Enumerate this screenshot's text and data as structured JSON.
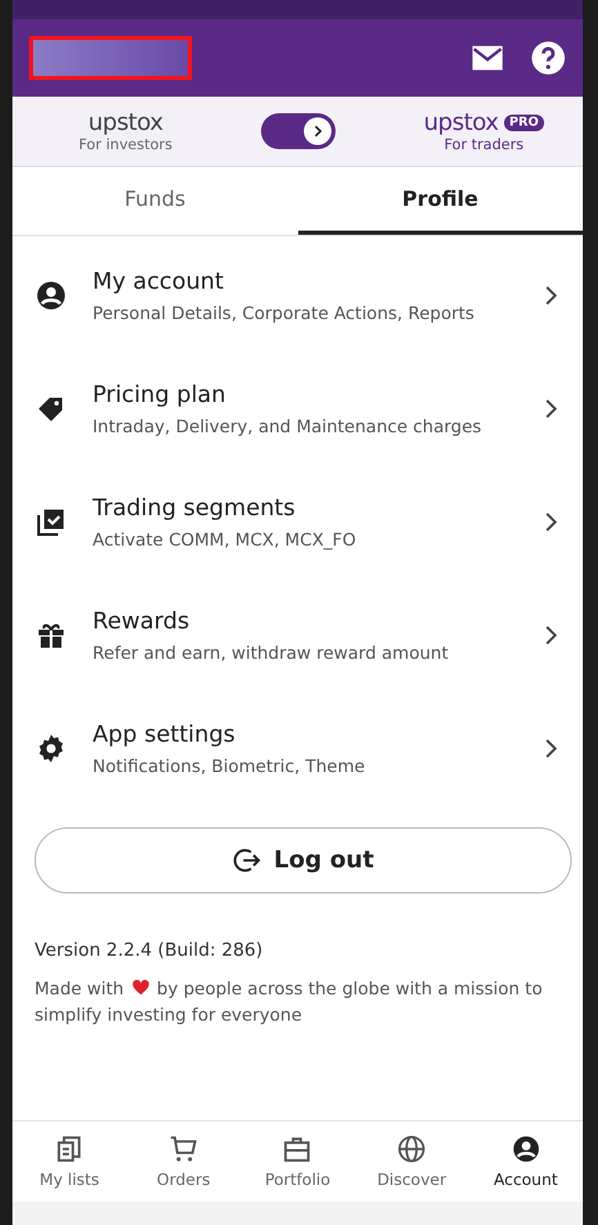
{
  "header": {
    "redacted": true
  },
  "switcher": {
    "left": {
      "logo": "upstox",
      "caption": "For investors"
    },
    "right": {
      "logo": "upstox",
      "badge": "PRO",
      "caption": "For traders"
    },
    "toggle_on": true
  },
  "tabs": [
    {
      "label": "Funds",
      "selected": false
    },
    {
      "label": "Profile",
      "selected": true
    }
  ],
  "menu": [
    {
      "title": "My account",
      "subtitle": "Personal Details, Corporate Actions, Reports"
    },
    {
      "title": "Pricing plan",
      "subtitle": "Intraday, Delivery, and Maintenance charges"
    },
    {
      "title": "Trading segments",
      "subtitle": "Activate COMM, MCX, MCX_FO"
    },
    {
      "title": "Rewards",
      "subtitle": "Refer and earn, withdraw reward amount"
    },
    {
      "title": "App settings",
      "subtitle": "Notifications, Biometric, Theme"
    }
  ],
  "logout": "Log out",
  "version": "Version 2.2.4 (Build: 286)",
  "tagline_before": "Made with",
  "tagline_after": "by people across the globe with a mission to simplify investing for everyone",
  "nav": [
    {
      "label": "My lists",
      "selected": false
    },
    {
      "label": "Orders",
      "selected": false
    },
    {
      "label": "Portfolio",
      "selected": false
    },
    {
      "label": "Discover",
      "selected": false
    },
    {
      "label": "Account",
      "selected": true
    }
  ]
}
